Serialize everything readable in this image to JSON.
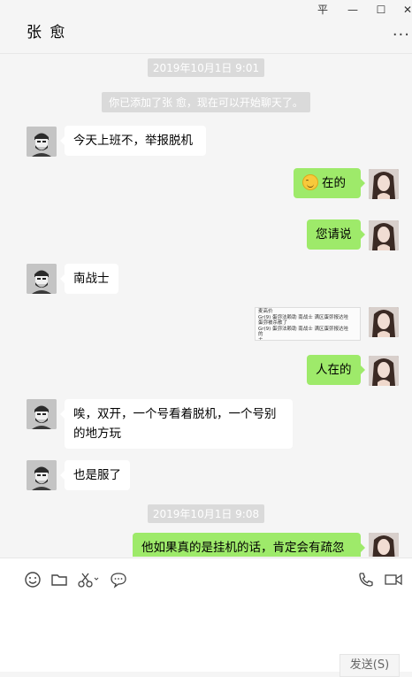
{
  "window": {
    "pin_glyph": "平",
    "minimize_glyph": "—",
    "maximize_glyph": "☐",
    "close_glyph": "✕"
  },
  "chat": {
    "title": "张 愈",
    "more_glyph": "..."
  },
  "messages": {
    "timestamp_1": "2019年10月1日 9:01",
    "system_notice": "你已添加了张 愈，现在可以开始聊天了。",
    "m1_text": "今天上班不，举报脱机",
    "m2_text": "在的",
    "m2_emoji": "smiley-emoji",
    "m3_text": "您请说",
    "m4_text": "南战士",
    "m5_lines": [
      "麦高价",
      "Gr(9)     蛋弥法赖助  南战士   满区蛋弥报达哇",
      "蛋弥被杀散了",
      "Gr(9)     蛋弥法赖助  南战士   满区蛋弥报达哇",
      "  的",
      "  主"
    ],
    "m6_text": "人在的",
    "m7_text": "唉，双开，一个号看着脱机，一个号别的地方玩",
    "m8_text": "也是服了",
    "timestamp_2": "2019年10月1日 9:08",
    "m9_text": "他如果真的是挂机的话，肯定会有疏忽"
  },
  "input": {
    "send_label": "发送(S)",
    "tools": [
      "emoji-icon",
      "folder-icon",
      "scissors-icon",
      "chat-bubble-icon"
    ],
    "right_tools": [
      "phone-icon",
      "video-icon"
    ]
  },
  "colors": {
    "outgoing_bubble": "#9eea6a",
    "incoming_bubble": "#ffffff",
    "background": "#f5f5f5"
  }
}
